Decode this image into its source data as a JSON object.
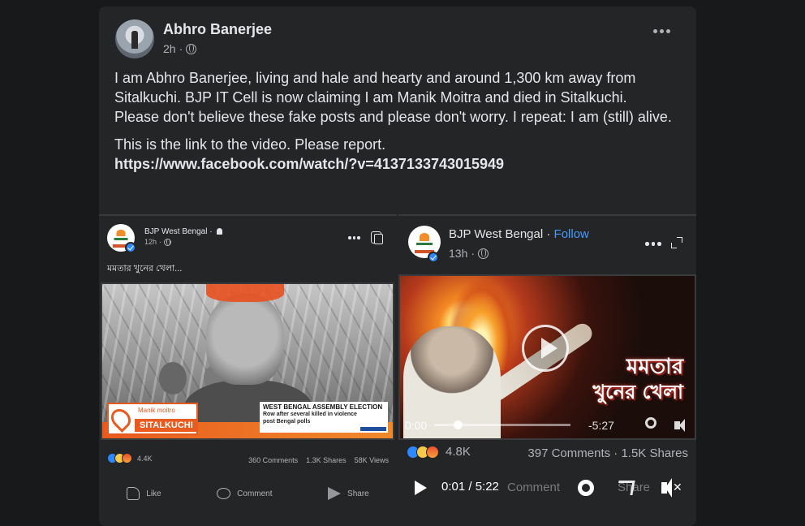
{
  "post": {
    "author": "Abhro Banerjee",
    "time": "2h",
    "body_p1": "I am Abhro Banerjee, living and hale and hearty and around 1,300 km away from Sitalkuchi. BJP IT Cell is now claiming I am Manik Moitra and died in Sitalkuchi. Please don't believe these fake posts and please don't worry. I repeat: I am (still) alive.",
    "body_p2": "This is the link to the video. Please report.",
    "link": "https://www.facebook.com/watch/?v=4137133743015949"
  },
  "left_shot": {
    "page_name": "BJP West Bengal",
    "time": "12h",
    "caption": "মমতার খুনের খেলা...",
    "pin_name": "Manik moitro",
    "pin_place": "SITALKUCHI",
    "headline_1": "WEST BENGAL ASSEMBLY ELECTION",
    "headline_2": "Row after several killed in violence",
    "headline_3": "post Bengal polls",
    "reactions": "4.4K",
    "comments": "360 Comments",
    "shares": "1.3K Shares",
    "views": "58K Views",
    "like_label": "Like",
    "comment_label": "Comment",
    "share_label": "Share"
  },
  "right_shot": {
    "page_name": "BJP West Bengal",
    "follow": "Follow",
    "time": "13h",
    "title_line1": "মমতার",
    "title_line2": "খুনের খেলা",
    "elapsed": "0:00",
    "remaining": "-5:27",
    "reactions": "4.8K",
    "stats": "397 Comments · 1.5K Shares",
    "player_time": "0:01 / 5:22",
    "comment_ghost": "Comment",
    "share_ghost": "Share",
    "close": "✕"
  }
}
